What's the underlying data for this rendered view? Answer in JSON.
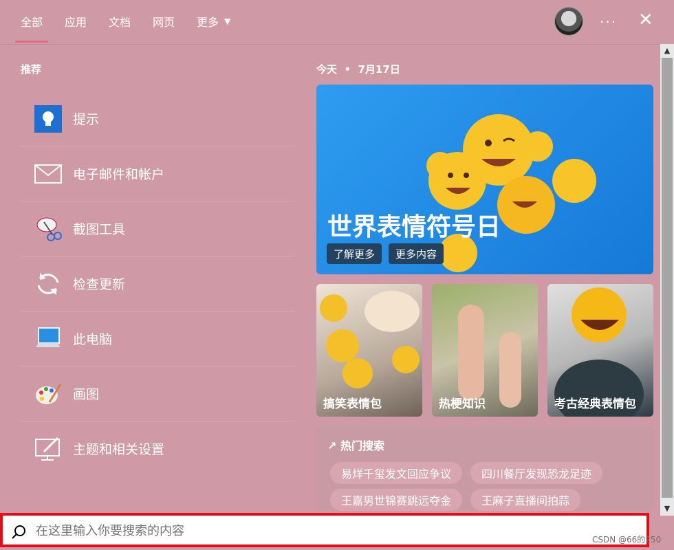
{
  "tabs": [
    {
      "label": "全部",
      "active": true
    },
    {
      "label": "应用"
    },
    {
      "label": "文档"
    },
    {
      "label": "网页"
    },
    {
      "label": "更多"
    }
  ],
  "header": {
    "more_icon": "chevron-down-icon",
    "dots": "···",
    "close": "✕"
  },
  "recommend": {
    "title": "推荐",
    "items": [
      {
        "label": "提示",
        "icon": "lightbulb-icon"
      },
      {
        "label": "电子邮件和帐户",
        "icon": "mail-icon"
      },
      {
        "label": "截图工具",
        "icon": "scissors-icon"
      },
      {
        "label": "检查更新",
        "icon": "refresh-icon"
      },
      {
        "label": "此电脑",
        "icon": "computer-icon"
      },
      {
        "label": "画图",
        "icon": "palette-icon"
      },
      {
        "label": "主题和相关设置",
        "icon": "theme-settings-icon"
      }
    ]
  },
  "today": {
    "label": "今天",
    "date": "7月17日",
    "hero_title": "世界表情符号日",
    "btn_learn": "了解更多",
    "btn_more": "更多内容"
  },
  "tiles": [
    {
      "label": "搞笑表情包"
    },
    {
      "label": "热梗知识"
    },
    {
      "label": "考古经典表情包"
    }
  ],
  "hot": {
    "title": "热门搜索",
    "chips": [
      "易烊千玺发文回应争议",
      "四川餐厅发现恐龙足迹",
      "王嘉男世锦赛跳远夺金",
      "王麻子直播间拍蒜"
    ]
  },
  "search": {
    "placeholder": "在这里输入你要搜索的内容"
  },
  "watermark": "CSDN @66的250",
  "colors": {
    "background": "#cf9aa5",
    "accent": "#e36a82",
    "search_border": "#e0101a",
    "hero_blue": "#1e88e5"
  }
}
